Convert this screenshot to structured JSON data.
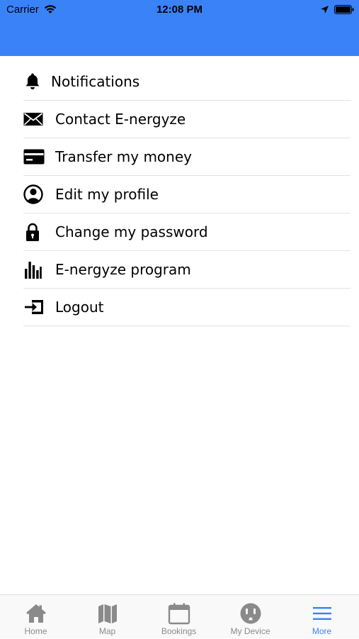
{
  "status_bar": {
    "carrier": "Carrier",
    "time": "12:08 PM"
  },
  "colors": {
    "header": "#3a82f7",
    "active_tab": "#3a82f7",
    "inactive_tab": "#8a8a8a"
  },
  "menu": {
    "items": [
      {
        "label": "Notifications",
        "icon": "bell-icon"
      },
      {
        "label": "Contact E-nergyze",
        "icon": "envelope-icon"
      },
      {
        "label": "Transfer my money",
        "icon": "credit-card-icon"
      },
      {
        "label": "Edit my profile",
        "icon": "user-circle-icon"
      },
      {
        "label": "Change my password",
        "icon": "lock-icon"
      },
      {
        "label": "E-nergyze program",
        "icon": "bar-chart-icon"
      },
      {
        "label": "Logout",
        "icon": "logout-icon"
      }
    ]
  },
  "tabbar": {
    "active": "More",
    "tabs": [
      {
        "label": "Home",
        "icon": "home-icon"
      },
      {
        "label": "Map",
        "icon": "map-icon"
      },
      {
        "label": "Bookings",
        "icon": "calendar-icon"
      },
      {
        "label": "My Device",
        "icon": "outlet-icon"
      },
      {
        "label": "More",
        "icon": "hamburger-icon"
      }
    ]
  }
}
